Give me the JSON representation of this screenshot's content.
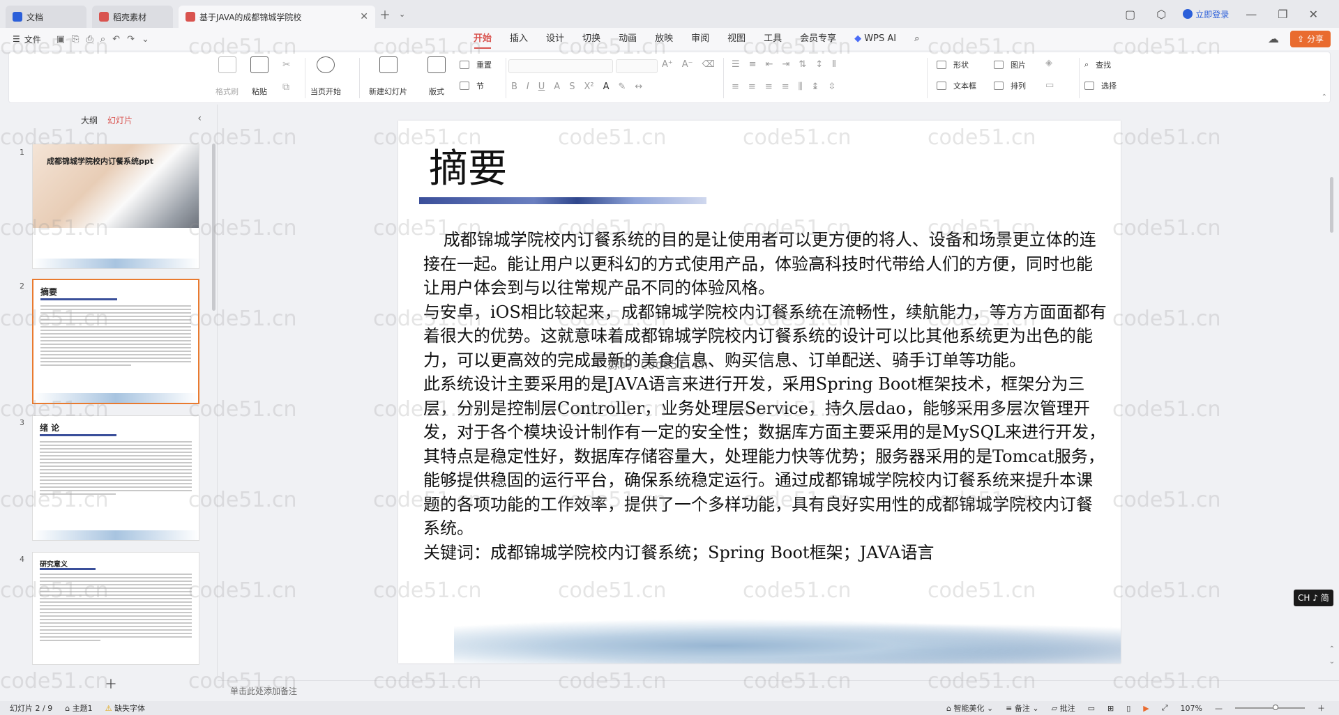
{
  "titlebar": {
    "tabs": [
      {
        "label": "文档",
        "color": "#2b5fd9",
        "active": false
      },
      {
        "label": "稻壳素材",
        "color": "#d9534f",
        "active": false
      },
      {
        "label": "基于JAVA的成都锦城学院校",
        "color": "#d9534f",
        "active": true
      }
    ],
    "login_label": "立即登录"
  },
  "menubar": {
    "file_label": "文件",
    "tabs": [
      "开始",
      "插入",
      "设计",
      "切换",
      "动画",
      "放映",
      "审阅",
      "视图",
      "工具",
      "会员专享"
    ],
    "wps_ai": "WPS AI",
    "share_label": "分享"
  },
  "ribbon": {
    "format_painter": "格式刷",
    "paste": "粘贴",
    "from_current": "当页开始",
    "new_slide": "新建幻灯片",
    "layout": "版式",
    "section": "节",
    "reset": "重置",
    "shape": "形状",
    "picture": "图片",
    "find": "查找",
    "textbox": "文本框",
    "arrange": "排列",
    "select": "选择"
  },
  "leftpanel": {
    "tab_outline": "大纲",
    "tab_slides": "幻灯片",
    "thumbs": [
      {
        "num": "1",
        "title": "成都锦城学院校内订餐系统ppt"
      },
      {
        "num": "2",
        "title": "摘要"
      },
      {
        "num": "3",
        "title": "绪 论"
      },
      {
        "num": "4",
        "title": "研究意义"
      }
    ]
  },
  "slide": {
    "title": "摘要",
    "paragraphs": [
      "成都锦城学院校内订餐系统的目的是让使用者可以更方便的将人、设备和场景更立体的连接在一起。能让用户以更科幻的方式使用产品，体验高科技时代带给人们的方便，同时也能让用户体会到与以往常规产品不同的体验风格。",
      "与安卓，iOS相比较起来，成都锦城学院校内订餐系统在流畅性，续航能力，等方方面面都有着很大的优势。这就意味着成都锦城学院校内订餐系统的设计可以比其他系统更为出色的能力，可以更高效的完成最新的美食信息、购买信息、订单配送、骑手订单等功能。",
      "此系统设计主要采用的是JAVA语言来进行开发，采用Spring Boot框架技术，框架分为三层，分别是控制层Controller，业务处理层Service，持久层dao，能够采用多层次管理开发，对于各个模块设计制作有一定的安全性；数据库方面主要采用的是MySQL来进行开发，其特点是稳定性好，数据库存储容量大，处理能力快等优势；服务器采用的是Tomcat服务，能够提供稳固的运行平台，确保系统稳定运行。通过成都锦城学院校内订餐系统来提升本课题的各项功能的工作效率，提供了一个多样功能，具有良好实用性的成都锦城学院校内订餐系统。",
      "关键词：成都锦城学院校内订餐系统；Spring Boot框架；JAVA语言"
    ],
    "overlay": "源码 code51.cn",
    "ime": "CH ♪ 简"
  },
  "notes_placeholder": "单击此处添加备注",
  "statusbar": {
    "slide_info": "幻灯片 2 / 9",
    "theme": "主题1",
    "missing_font": "缺失字体",
    "beautify": "智能美化",
    "notes": "备注",
    "comments": "批注",
    "zoom": "107%"
  },
  "watermark": "code51.cn"
}
